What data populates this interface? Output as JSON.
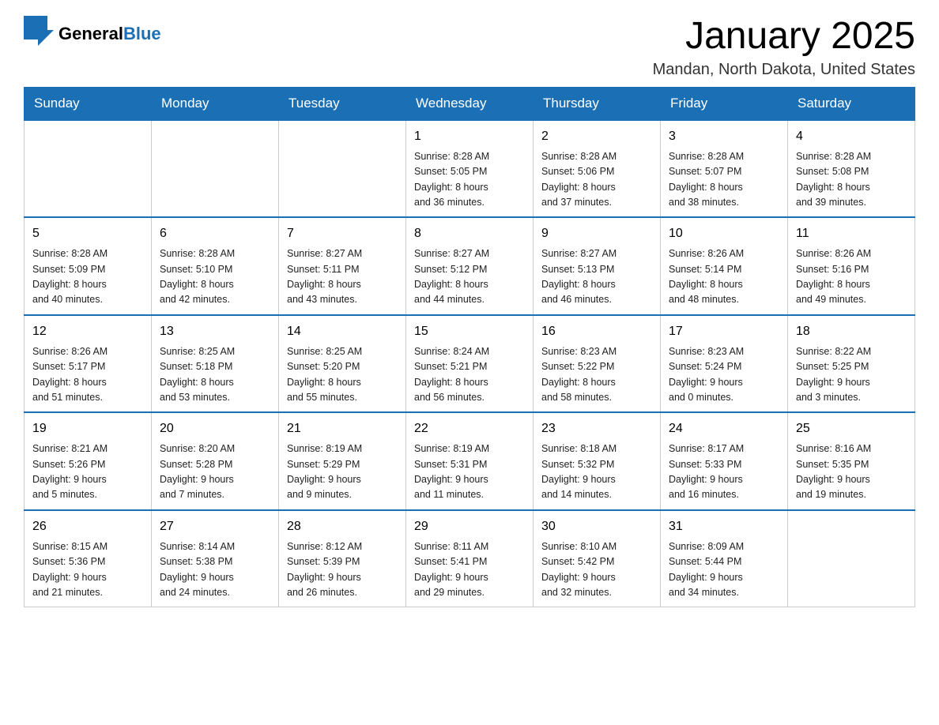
{
  "header": {
    "logo_general": "General",
    "logo_blue": "Blue",
    "month_title": "January 2025",
    "location": "Mandan, North Dakota, United States"
  },
  "days_of_week": [
    "Sunday",
    "Monday",
    "Tuesday",
    "Wednesday",
    "Thursday",
    "Friday",
    "Saturday"
  ],
  "weeks": [
    [
      {
        "day": "",
        "info": ""
      },
      {
        "day": "",
        "info": ""
      },
      {
        "day": "",
        "info": ""
      },
      {
        "day": "1",
        "info": "Sunrise: 8:28 AM\nSunset: 5:05 PM\nDaylight: 8 hours\nand 36 minutes."
      },
      {
        "day": "2",
        "info": "Sunrise: 8:28 AM\nSunset: 5:06 PM\nDaylight: 8 hours\nand 37 minutes."
      },
      {
        "day": "3",
        "info": "Sunrise: 8:28 AM\nSunset: 5:07 PM\nDaylight: 8 hours\nand 38 minutes."
      },
      {
        "day": "4",
        "info": "Sunrise: 8:28 AM\nSunset: 5:08 PM\nDaylight: 8 hours\nand 39 minutes."
      }
    ],
    [
      {
        "day": "5",
        "info": "Sunrise: 8:28 AM\nSunset: 5:09 PM\nDaylight: 8 hours\nand 40 minutes."
      },
      {
        "day": "6",
        "info": "Sunrise: 8:28 AM\nSunset: 5:10 PM\nDaylight: 8 hours\nand 42 minutes."
      },
      {
        "day": "7",
        "info": "Sunrise: 8:27 AM\nSunset: 5:11 PM\nDaylight: 8 hours\nand 43 minutes."
      },
      {
        "day": "8",
        "info": "Sunrise: 8:27 AM\nSunset: 5:12 PM\nDaylight: 8 hours\nand 44 minutes."
      },
      {
        "day": "9",
        "info": "Sunrise: 8:27 AM\nSunset: 5:13 PM\nDaylight: 8 hours\nand 46 minutes."
      },
      {
        "day": "10",
        "info": "Sunrise: 8:26 AM\nSunset: 5:14 PM\nDaylight: 8 hours\nand 48 minutes."
      },
      {
        "day": "11",
        "info": "Sunrise: 8:26 AM\nSunset: 5:16 PM\nDaylight: 8 hours\nand 49 minutes."
      }
    ],
    [
      {
        "day": "12",
        "info": "Sunrise: 8:26 AM\nSunset: 5:17 PM\nDaylight: 8 hours\nand 51 minutes."
      },
      {
        "day": "13",
        "info": "Sunrise: 8:25 AM\nSunset: 5:18 PM\nDaylight: 8 hours\nand 53 minutes."
      },
      {
        "day": "14",
        "info": "Sunrise: 8:25 AM\nSunset: 5:20 PM\nDaylight: 8 hours\nand 55 minutes."
      },
      {
        "day": "15",
        "info": "Sunrise: 8:24 AM\nSunset: 5:21 PM\nDaylight: 8 hours\nand 56 minutes."
      },
      {
        "day": "16",
        "info": "Sunrise: 8:23 AM\nSunset: 5:22 PM\nDaylight: 8 hours\nand 58 minutes."
      },
      {
        "day": "17",
        "info": "Sunrise: 8:23 AM\nSunset: 5:24 PM\nDaylight: 9 hours\nand 0 minutes."
      },
      {
        "day": "18",
        "info": "Sunrise: 8:22 AM\nSunset: 5:25 PM\nDaylight: 9 hours\nand 3 minutes."
      }
    ],
    [
      {
        "day": "19",
        "info": "Sunrise: 8:21 AM\nSunset: 5:26 PM\nDaylight: 9 hours\nand 5 minutes."
      },
      {
        "day": "20",
        "info": "Sunrise: 8:20 AM\nSunset: 5:28 PM\nDaylight: 9 hours\nand 7 minutes."
      },
      {
        "day": "21",
        "info": "Sunrise: 8:19 AM\nSunset: 5:29 PM\nDaylight: 9 hours\nand 9 minutes."
      },
      {
        "day": "22",
        "info": "Sunrise: 8:19 AM\nSunset: 5:31 PM\nDaylight: 9 hours\nand 11 minutes."
      },
      {
        "day": "23",
        "info": "Sunrise: 8:18 AM\nSunset: 5:32 PM\nDaylight: 9 hours\nand 14 minutes."
      },
      {
        "day": "24",
        "info": "Sunrise: 8:17 AM\nSunset: 5:33 PM\nDaylight: 9 hours\nand 16 minutes."
      },
      {
        "day": "25",
        "info": "Sunrise: 8:16 AM\nSunset: 5:35 PM\nDaylight: 9 hours\nand 19 minutes."
      }
    ],
    [
      {
        "day": "26",
        "info": "Sunrise: 8:15 AM\nSunset: 5:36 PM\nDaylight: 9 hours\nand 21 minutes."
      },
      {
        "day": "27",
        "info": "Sunrise: 8:14 AM\nSunset: 5:38 PM\nDaylight: 9 hours\nand 24 minutes."
      },
      {
        "day": "28",
        "info": "Sunrise: 8:12 AM\nSunset: 5:39 PM\nDaylight: 9 hours\nand 26 minutes."
      },
      {
        "day": "29",
        "info": "Sunrise: 8:11 AM\nSunset: 5:41 PM\nDaylight: 9 hours\nand 29 minutes."
      },
      {
        "day": "30",
        "info": "Sunrise: 8:10 AM\nSunset: 5:42 PM\nDaylight: 9 hours\nand 32 minutes."
      },
      {
        "day": "31",
        "info": "Sunrise: 8:09 AM\nSunset: 5:44 PM\nDaylight: 9 hours\nand 34 minutes."
      },
      {
        "day": "",
        "info": ""
      }
    ]
  ]
}
